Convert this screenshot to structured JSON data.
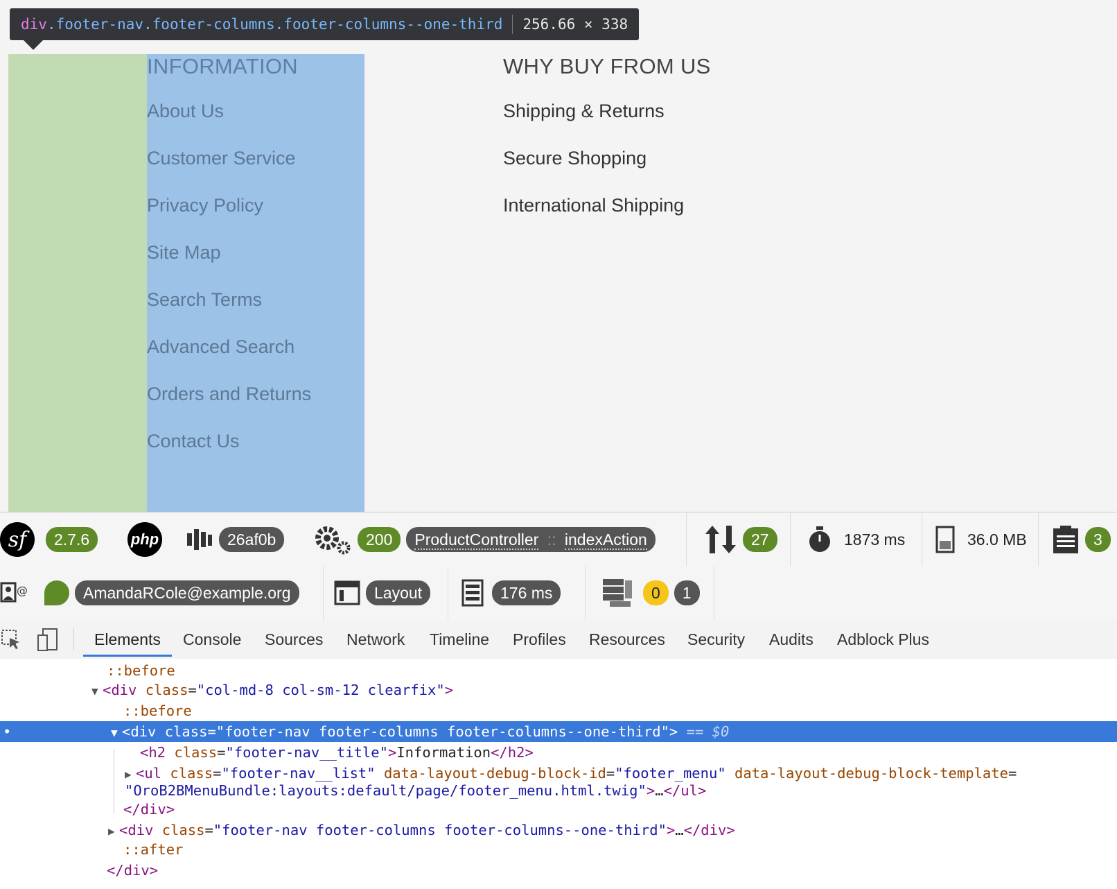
{
  "tooltip": {
    "tag": "div",
    "classes": ".footer-nav.footer-columns.footer-columns--one-third",
    "dims": "256.66 × 338"
  },
  "footer": {
    "info_title": "INFORMATION",
    "info_links": [
      "About Us",
      "Customer Service",
      "Privacy Policy",
      "Site Map",
      "Search Terms",
      "Advanced Search",
      "Orders and Returns",
      "Contact Us"
    ],
    "why_title": "WHY BUY FROM US",
    "why_links": [
      "Shipping & Returns",
      "Secure Shopping",
      "International Shipping"
    ]
  },
  "symfony_toolbar": {
    "version": "2.7.6",
    "php_label": "php",
    "token": "26af0b",
    "status": "200",
    "controller": "ProductController",
    "controller_sep": "::",
    "action": "indexAction",
    "requests": "27",
    "time": "1873 ms",
    "memory": "36.0 MB",
    "logs": "3",
    "user": "AmandaRCole@example.org",
    "layout": "Layout",
    "db_time": "176 ms",
    "cache_warn": "0",
    "cache_count": "1"
  },
  "devtools": {
    "tabs": [
      "Elements",
      "Console",
      "Sources",
      "Network",
      "Timeline",
      "Profiles",
      "Resources",
      "Security",
      "Audits",
      "Adblock Plus"
    ],
    "dom": {
      "before1": "::before",
      "div_tag": "div",
      "class_attr": "class",
      "col_class": "col-md-8 col-sm-12 clearfix",
      "before2": "::before",
      "selected_class": "footer-nav footer-columns footer-columns--one-third",
      "selected_suffix": "== $0",
      "h2_tag": "h2",
      "h2_class": "footer-nav__title",
      "h2_text": "Information",
      "ul_tag": "ul",
      "ul_class": "footer-nav__list",
      "ul_attr1": "data-layout-debug-block-id",
      "ul_attr1_val": "footer_menu",
      "ul_attr2": "data-layout-debug-block-template",
      "ul_attr2_val": "OroB2BMenuBundle:layouts:default/page/footer_menu.html.twig",
      "ellipsis": "…",
      "after": "::after"
    }
  }
}
